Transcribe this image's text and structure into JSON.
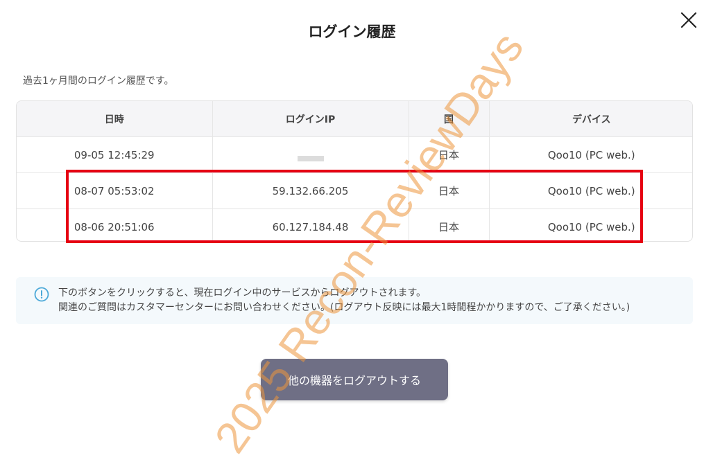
{
  "dialog": {
    "title": "ログイン履歴",
    "subtitle": "過去1ヶ月間のログイン履歴です。"
  },
  "table": {
    "headers": [
      "日時",
      "ログインIP",
      "国",
      "デバイス"
    ],
    "rows": [
      {
        "datetime": "09-05 12:45:29",
        "ip": "",
        "country": "日本",
        "device": "Qoo10 (PC web.)"
      },
      {
        "datetime": "08-07 05:53:02",
        "ip": "59.132.66.205",
        "country": "日本",
        "device": "Qoo10 (PC web.)"
      },
      {
        "datetime": "08-06 20:51:06",
        "ip": "60.127.184.48",
        "country": "日本",
        "device": "Qoo10 (PC web.)"
      }
    ]
  },
  "notice": {
    "icon": "info-icon",
    "line1": "下のボタンをクリックすると、現在ログイン中のサービスからログアウトされます。",
    "line2": "関連のご質問はカスタマーセンターにお問い合わせください。(ログアウト反映には最大1時間程かかりますので、ご了承ください。)"
  },
  "logout_button": {
    "label": "他の機器をログアウトする"
  },
  "watermark": {
    "text": "2025 Recon-ReviewDays"
  },
  "colors": {
    "highlight": "#e60012",
    "button": "#6f6f85",
    "notice_bg": "#f4f9fc",
    "info_icon": "#4aa8d8",
    "watermark": "#ec963c"
  }
}
